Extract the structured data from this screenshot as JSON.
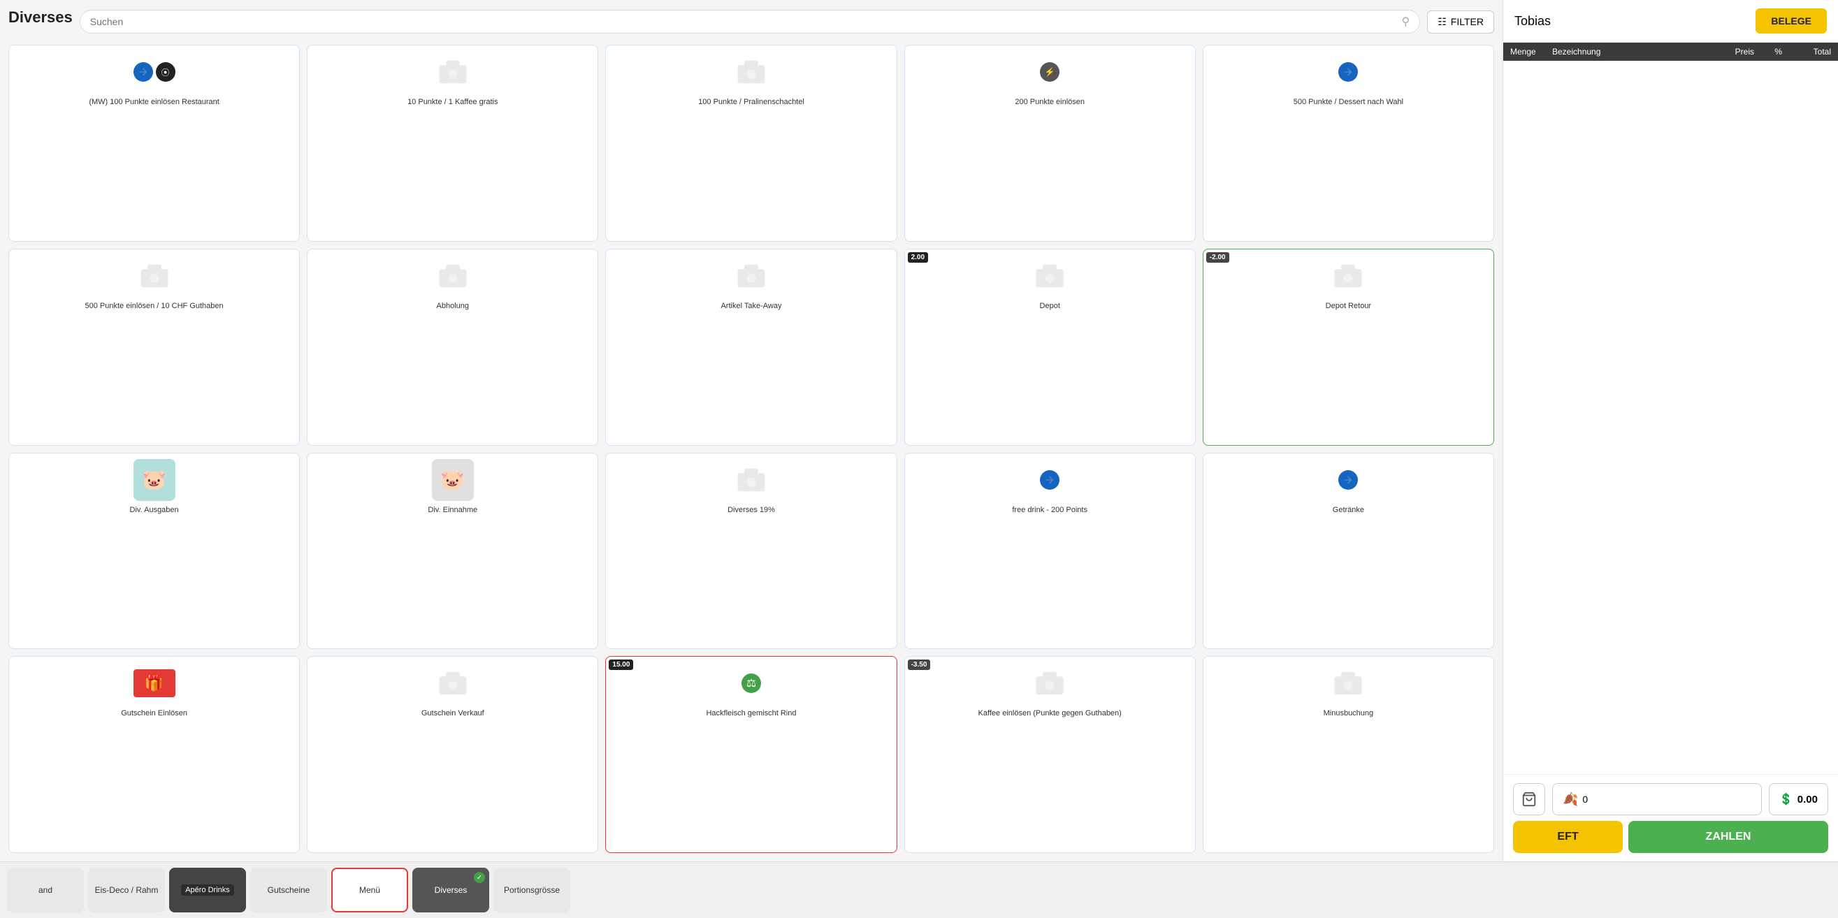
{
  "header": {
    "title": "Diverses",
    "search_placeholder": "Suchen",
    "filter_label": "FILTER"
  },
  "right": {
    "user_name": "Tobias",
    "belege_label": "BELEGE",
    "table_headers": [
      "Menge",
      "Bezeichnung",
      "Preis",
      "%",
      "Total"
    ],
    "cart_count": "0",
    "cart_total": "0.00",
    "eft_label": "EFT",
    "pay_label": "ZAHLEN"
  },
  "products": [
    {
      "id": 1,
      "name": "(MW) 100 Punkte einlösen Restaurant",
      "price": null,
      "badge": null,
      "icon_type": "dual_blue",
      "border": "blue"
    },
    {
      "id": 2,
      "name": "10 Punkte / 1 Kaffee gratis",
      "price": null,
      "badge": null,
      "icon_type": "generic",
      "border": "blue"
    },
    {
      "id": 3,
      "name": "100 Punkte / Pralinenschachtel",
      "price": null,
      "badge": null,
      "icon_type": "generic",
      "border": "blue"
    },
    {
      "id": 4,
      "name": "200 Punkte einlösen",
      "price": null,
      "badge": null,
      "icon_type": "dark_circle",
      "border": "blue"
    },
    {
      "id": 5,
      "name": "500 Punkte / Dessert nach Wahl",
      "price": null,
      "badge": null,
      "icon_type": "blue_arrow",
      "border": "blue"
    },
    {
      "id": 6,
      "name": "500 Punkte einlösen / 10 CHF Guthaben",
      "price": null,
      "badge": null,
      "icon_type": "generic",
      "border": "blue"
    },
    {
      "id": 7,
      "name": "Abholung",
      "price": null,
      "badge": null,
      "icon_type": "generic",
      "border": "blue"
    },
    {
      "id": 8,
      "name": "Artikel Take-Away",
      "price": null,
      "badge": null,
      "icon_type": "generic",
      "border": "blue"
    },
    {
      "id": 9,
      "name": "Depot",
      "price": "2.00",
      "badge": "2.00",
      "icon_type": "generic",
      "border": "blue"
    },
    {
      "id": 10,
      "name": "Depot Retour",
      "price": "-2.00",
      "badge": "-2.00",
      "icon_type": "generic",
      "border": "green"
    },
    {
      "id": 11,
      "name": "Div. Ausgaben",
      "price": null,
      "badge": null,
      "icon_type": "piggy_bandage",
      "border": "blue"
    },
    {
      "id": 12,
      "name": "Div. Einnahme",
      "price": null,
      "badge": null,
      "icon_type": "piggy_plain",
      "border": "blue"
    },
    {
      "id": 13,
      "name": "Diverses 19%",
      "price": null,
      "badge": null,
      "icon_type": "generic",
      "border": "blue"
    },
    {
      "id": 14,
      "name": "free drink - 200 Points",
      "price": null,
      "badge": null,
      "icon_type": "blue_arrow",
      "border": "blue"
    },
    {
      "id": 15,
      "name": "Getränke",
      "price": null,
      "badge": null,
      "icon_type": "blue_arrow",
      "border": "blue"
    },
    {
      "id": 16,
      "name": "Gutschein Einlösen",
      "price": null,
      "badge": null,
      "icon_type": "gift_card",
      "border": "blue"
    },
    {
      "id": 17,
      "name": "Gutschein Verkauf",
      "price": null,
      "badge": null,
      "icon_type": "generic",
      "border": "blue"
    },
    {
      "id": 18,
      "name": "Hackfleisch gemischt Rind",
      "price": "15.00",
      "badge": "15.00",
      "icon_type": "green_scale",
      "border": "red"
    },
    {
      "id": 19,
      "name": "Kaffee einlösen (Punkte gegen Guthaben)",
      "price": null,
      "badge": "-3.50",
      "icon_type": "generic",
      "border": "blue"
    },
    {
      "id": 20,
      "name": "Minusbuchung",
      "price": null,
      "badge": null,
      "icon_type": "generic",
      "border": "blue"
    }
  ],
  "categories": [
    {
      "id": "and",
      "label": "and",
      "active": false,
      "style": "dim"
    },
    {
      "id": "eis",
      "label": "Eis-Deco / Rahm",
      "active": false,
      "style": "dim"
    },
    {
      "id": "apero",
      "label": "Apéro Drinks",
      "active": false,
      "style": "dark_bg"
    },
    {
      "id": "gutscheine",
      "label": "Gutscheine",
      "active": false,
      "style": "plain"
    },
    {
      "id": "menu",
      "label": "Menü",
      "active": false,
      "style": "red_border"
    },
    {
      "id": "diverses",
      "label": "Diverses",
      "active": true,
      "style": "dark"
    },
    {
      "id": "portion",
      "label": "Portionsgrösse",
      "active": false,
      "style": "plain"
    }
  ]
}
